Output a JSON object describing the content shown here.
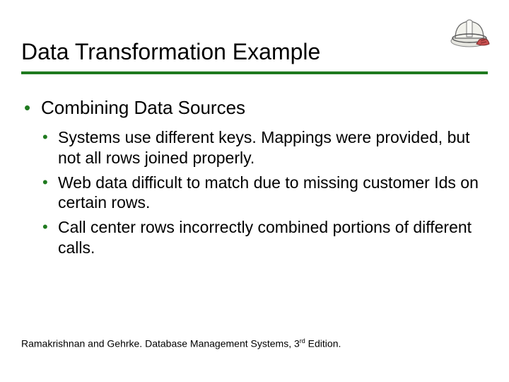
{
  "title": "Data Transformation Example",
  "colors": {
    "accent": "#1f7a1f"
  },
  "icons": {
    "corner": "hardhat-icon"
  },
  "bullets": {
    "level1": [
      {
        "text": "Combining Data Sources",
        "children": [
          "Systems use different keys.  Mappings were provided, but not all rows joined properly.",
          "Web data difficult to match due to missing customer Ids on certain rows.",
          "Call center rows incorrectly combined portions of different calls."
        ]
      }
    ]
  },
  "footer": {
    "prefix": "Ramakrishnan and Gehrke. Database Management Systems, 3",
    "sup": "rd",
    "suffix": " Edition."
  }
}
